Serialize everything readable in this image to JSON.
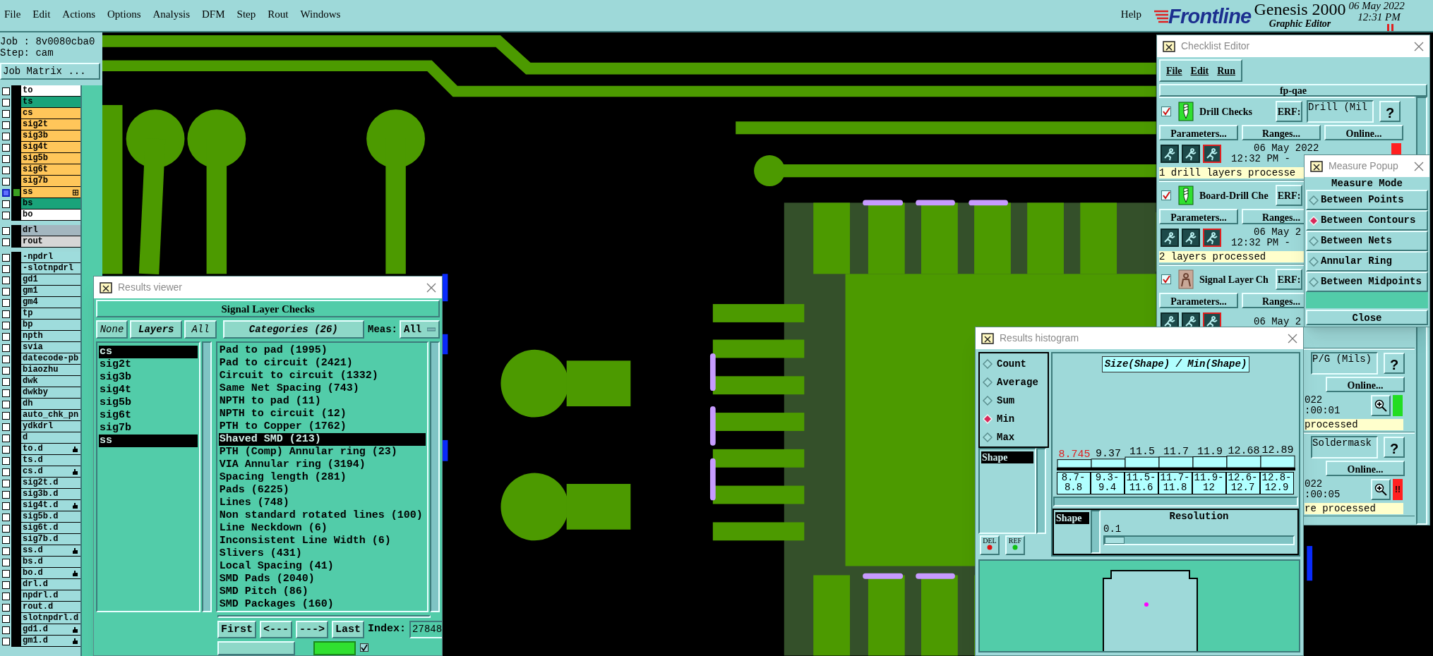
{
  "menu_bar": {
    "items": [
      "File",
      "Edit",
      "Actions",
      "Options",
      "Analysis",
      "DFM",
      "Step",
      "Rout",
      "Windows"
    ],
    "help": "Help"
  },
  "branding": {
    "logo": "Frontline",
    "product": "Genesis 2000",
    "subtitle": "Graphic Editor",
    "date": "06 May 2022",
    "time": "12:31 PM"
  },
  "job_panel": {
    "job": "Job : 8v0080cba0",
    "step": "Step: cam",
    "matrix_button": "Job Matrix ...",
    "layer_groups": [
      [
        {
          "name": "to",
          "color": "#ffffff",
          "selected": false,
          "hand": false
        },
        {
          "name": "ts",
          "color": "#1aa37a",
          "selected": false,
          "hand": false
        },
        {
          "name": "cs",
          "color": "#ffc65a",
          "selected": false,
          "hand": false
        },
        {
          "name": "sig2t",
          "color": "#ffc65a",
          "selected": false,
          "hand": false
        },
        {
          "name": "sig3b",
          "color": "#ffc65a",
          "selected": false,
          "hand": false
        },
        {
          "name": "sig4t",
          "color": "#ffc65a",
          "selected": false,
          "hand": false
        },
        {
          "name": "sig5b",
          "color": "#ffc65a",
          "selected": false,
          "hand": false
        },
        {
          "name": "sig6t",
          "color": "#ffc65a",
          "selected": false,
          "hand": false
        },
        {
          "name": "sig7b",
          "color": "#ffc65a",
          "selected": false,
          "hand": false
        },
        {
          "name": "ss",
          "color": "#ffc65a",
          "selected": true,
          "hand": false
        },
        {
          "name": "bs",
          "color": "#1aa37a",
          "selected": false,
          "hand": false
        },
        {
          "name": "bo",
          "color": "#ffffff",
          "selected": false,
          "hand": false
        }
      ],
      [
        {
          "name": "drl",
          "color": "#a3b6bf",
          "selected": false,
          "hand": false
        },
        {
          "name": "rout",
          "color": "#d6d6d6",
          "selected": false,
          "hand": false
        }
      ],
      [
        {
          "name": "-npdrl",
          "color": "#9edcdc",
          "selected": false,
          "hand": false
        },
        {
          "name": "-slotnpdrl",
          "color": "#9edcdc",
          "selected": false,
          "hand": false
        },
        {
          "name": "gd1",
          "color": "#9edcdc",
          "selected": false,
          "hand": false
        },
        {
          "name": "gm1",
          "color": "#9edcdc",
          "selected": false,
          "hand": false
        },
        {
          "name": "gm4",
          "color": "#9edcdc",
          "selected": false,
          "hand": false
        },
        {
          "name": "tp",
          "color": "#9edcdc",
          "selected": false,
          "hand": false
        },
        {
          "name": "bp",
          "color": "#9edcdc",
          "selected": false,
          "hand": false
        },
        {
          "name": "npth",
          "color": "#9edcdc",
          "selected": false,
          "hand": false
        },
        {
          "name": "svia",
          "color": "#9edcdc",
          "selected": false,
          "hand": false
        },
        {
          "name": "datecode-pb",
          "color": "#9edcdc",
          "selected": false,
          "hand": false
        },
        {
          "name": "biaozhu",
          "color": "#9edcdc",
          "selected": false,
          "hand": false
        },
        {
          "name": "dwk",
          "color": "#9edcdc",
          "selected": false,
          "hand": false
        },
        {
          "name": "dwkby",
          "color": "#9edcdc",
          "selected": false,
          "hand": false
        },
        {
          "name": "dh",
          "color": "#9edcdc",
          "selected": false,
          "hand": false
        },
        {
          "name": "auto_chk_pn",
          "color": "#9edcdc",
          "selected": false,
          "hand": false
        },
        {
          "name": "ydkdrl",
          "color": "#9edcdc",
          "selected": false,
          "hand": false
        },
        {
          "name": "d",
          "color": "#9edcdc",
          "selected": false,
          "hand": false
        },
        {
          "name": "to.d",
          "color": "#9edcdc",
          "selected": false,
          "hand": true
        },
        {
          "name": "ts.d",
          "color": "#9edcdc",
          "selected": false,
          "hand": false
        },
        {
          "name": "cs.d",
          "color": "#9edcdc",
          "selected": false,
          "hand": true
        },
        {
          "name": "sig2t.d",
          "color": "#9edcdc",
          "selected": false,
          "hand": false
        },
        {
          "name": "sig3b.d",
          "color": "#9edcdc",
          "selected": false,
          "hand": false
        },
        {
          "name": "sig4t.d",
          "color": "#9edcdc",
          "selected": false,
          "hand": true
        },
        {
          "name": "sig5b.d",
          "color": "#9edcdc",
          "selected": false,
          "hand": false
        },
        {
          "name": "sig6t.d",
          "color": "#9edcdc",
          "selected": false,
          "hand": false
        },
        {
          "name": "sig7b.d",
          "color": "#9edcdc",
          "selected": false,
          "hand": false
        },
        {
          "name": "ss.d",
          "color": "#9edcdc",
          "selected": false,
          "hand": true
        },
        {
          "name": "bs.d",
          "color": "#9edcdc",
          "selected": false,
          "hand": false
        },
        {
          "name": "bo.d",
          "color": "#9edcdc",
          "selected": false,
          "hand": true
        },
        {
          "name": "drl.d",
          "color": "#9edcdc",
          "selected": false,
          "hand": false
        },
        {
          "name": "npdrl.d",
          "color": "#9edcdc",
          "selected": false,
          "hand": false
        },
        {
          "name": "rout.d",
          "color": "#9edcdc",
          "selected": false,
          "hand": false
        },
        {
          "name": "slotnpdrl.d",
          "color": "#9edcdc",
          "selected": false,
          "hand": false
        },
        {
          "name": "gd1.d",
          "color": "#9edcdc",
          "selected": false,
          "hand": true
        },
        {
          "name": "gm1.d",
          "color": "#9edcdc",
          "selected": false,
          "hand": true
        }
      ]
    ]
  },
  "results_viewer": {
    "title": "Results viewer",
    "header": "Signal Layer Checks",
    "layer_buttons": [
      {
        "label": "None",
        "kind": "action"
      },
      {
        "label": "Layers",
        "kind": "title"
      },
      {
        "label": "All",
        "kind": "action"
      }
    ],
    "layers": [
      {
        "name": "cs",
        "selected": true
      },
      {
        "name": "sig2t",
        "selected": false
      },
      {
        "name": "sig3b",
        "selected": false
      },
      {
        "name": "sig4t",
        "selected": false
      },
      {
        "name": "sig5b",
        "selected": false
      },
      {
        "name": "sig6t",
        "selected": false
      },
      {
        "name": "sig7b",
        "selected": false
      },
      {
        "name": "ss",
        "selected": true
      }
    ],
    "categories_button": "Categories (26)",
    "meas_label": "Meas:",
    "meas_value": "All",
    "categories": [
      {
        "label": "Pad to pad (1995)",
        "selected": false
      },
      {
        "label": "Pad to circuit (2421)",
        "selected": false
      },
      {
        "label": "Circuit to circuit (1332)",
        "selected": false
      },
      {
        "label": "Same Net Spacing (743)",
        "selected": false
      },
      {
        "label": "NPTH to pad (11)",
        "selected": false
      },
      {
        "label": "NPTH to circuit (12)",
        "selected": false
      },
      {
        "label": "PTH to Copper (1762)",
        "selected": false
      },
      {
        "label": "Shaved SMD (213)",
        "selected": true
      },
      {
        "label": "PTH (Comp) Annular ring (23)",
        "selected": false
      },
      {
        "label": "VIA Annular ring (3194)",
        "selected": false
      },
      {
        "label": "Spacing length (281)",
        "selected": false
      },
      {
        "label": "Pads (6225)",
        "selected": false
      },
      {
        "label": "Lines (748)",
        "selected": false
      },
      {
        "label": "Non standard rotated lines (100)",
        "selected": false
      },
      {
        "label": "Line Neckdown (6)",
        "selected": false
      },
      {
        "label": "Inconsistent Line Width (6)",
        "selected": false
      },
      {
        "label": "Slivers (431)",
        "selected": false
      },
      {
        "label": "Local Spacing (41)",
        "selected": false
      },
      {
        "label": "SMD Pads (2040)",
        "selected": false
      },
      {
        "label": "SMD Pitch (86)",
        "selected": false
      },
      {
        "label": "SMD Packages (160)",
        "selected": false
      }
    ],
    "nav_buttons": [
      "First",
      "<---",
      "--->",
      "Last"
    ],
    "index_label": "Index:",
    "index_value": "27848",
    "show_all_checked": true
  },
  "checklist_editor": {
    "title": "Checklist Editor",
    "menu": [
      "File",
      "Edit",
      "Run"
    ],
    "name": "fp-qae",
    "checks": [
      {
        "kind": "drill",
        "checked": true,
        "name": "Drill Checks",
        "erf": "ERF:",
        "erf_value": "Drill (Mil",
        "help": "?",
        "buttons": [
          "Parameters...",
          "Ranges...",
          "Online..."
        ],
        "date": "06 May 2022",
        "time": "12:32 PM -",
        "color": "#ff2020",
        "status": "1 drill layers processe"
      },
      {
        "kind": "drill",
        "checked": true,
        "name": "Board-Drill Che",
        "erf": "ERF:",
        "buttons": [
          "Parameters...",
          "Ranges..."
        ],
        "date": "06 May 2",
        "time": "12:32 PM -",
        "status": "2 layers processed"
      },
      {
        "kind": "signal",
        "checked": true,
        "name": "Signal Layer Ch",
        "erf": "ERF:",
        "buttons": [
          "Parameters...",
          "Ranges..."
        ],
        "date": "06 May 2"
      },
      {
        "kind": "partial",
        "erf_value": "P/G (Mils)",
        "help": "?",
        "buttons": [
          "Online..."
        ],
        "date": "022",
        "time": ":00:01",
        "color": "#22dd22",
        "status": "processed"
      },
      {
        "kind": "partial",
        "erf_value": "Soldermask",
        "help": "?",
        "buttons": [
          "Online..."
        ],
        "date": "022",
        "time": ":00:05",
        "color": "#ff2020",
        "result_text": "!!",
        "status": "re processed"
      }
    ]
  },
  "measure_popup": {
    "title": "Measure Popup",
    "heading": "Measure Mode",
    "options": [
      {
        "label": "Between Points",
        "selected": false
      },
      {
        "label": "Between Contours",
        "selected": true
      },
      {
        "label": "Between Nets",
        "selected": false
      },
      {
        "label": "Annular Ring",
        "selected": false
      },
      {
        "label": "Between Midpoints",
        "selected": false
      }
    ],
    "close": "Close"
  },
  "results_histogram": {
    "title": "Results histogram",
    "modes": [
      {
        "label": "Count",
        "selected": false
      },
      {
        "label": "Average",
        "selected": false
      },
      {
        "label": "Sum",
        "selected": false
      },
      {
        "label": "Min",
        "selected": true
      },
      {
        "label": "Max",
        "selected": false
      }
    ],
    "attributes": [
      {
        "label": "Shape",
        "selected": true
      }
    ],
    "del": "DEL",
    "ref": "REF",
    "chart_data": {
      "type": "bar",
      "title": "Size(Shape) / Min(Shape)",
      "categories": [
        "8.7-8.8",
        "9.3-9.4",
        "11.5-11.6",
        "11.7-11.8",
        "11.9-12",
        "12.6-12.7",
        "12.8-12.9"
      ],
      "values": [
        8.745,
        9.37,
        11.5,
        11.7,
        11.9,
        12.68,
        12.89
      ],
      "data_labels": true
    },
    "group_by": [
      {
        "label": "Shape",
        "selected": true
      }
    ],
    "resolution_label": "Resolution",
    "resolution_value": "0.1",
    "resolution_slider": {
      "level": 0
    }
  }
}
